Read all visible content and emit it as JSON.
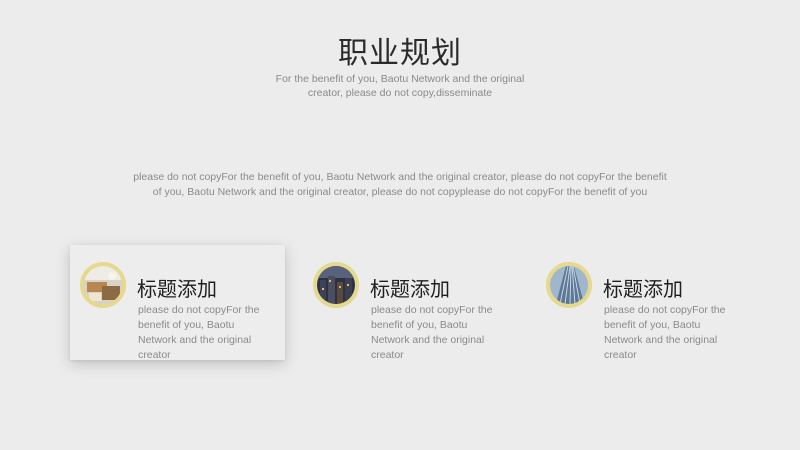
{
  "header": {
    "title": "职业规划",
    "subtitle": "For the benefit of you, Baotu Network and the original creator, please do not copy,disseminate"
  },
  "intro": {
    "text": "please do not copyFor the benefit of you, Baotu Network and the original creator, please do not copyFor the benefit of you, Baotu Network and the original creator, please do not copyplease do not copyFor the benefit of you"
  },
  "cards": [
    {
      "title": "标题添加",
      "text": "please do not copyFor the benefit of you, Baotu Network and the original creator",
      "icon": "office-photo-icon"
    },
    {
      "title": "标题添加",
      "text": "please do not copyFor the benefit of you, Baotu Network and the original creator",
      "icon": "city-night-photo-icon"
    },
    {
      "title": "标题添加",
      "text": "please do not copyFor the benefit of you, Baotu Network and the original creator",
      "icon": "skyscraper-photo-icon"
    }
  ],
  "colors": {
    "background": "#ececec",
    "accent_ring": "#e6d98e"
  }
}
